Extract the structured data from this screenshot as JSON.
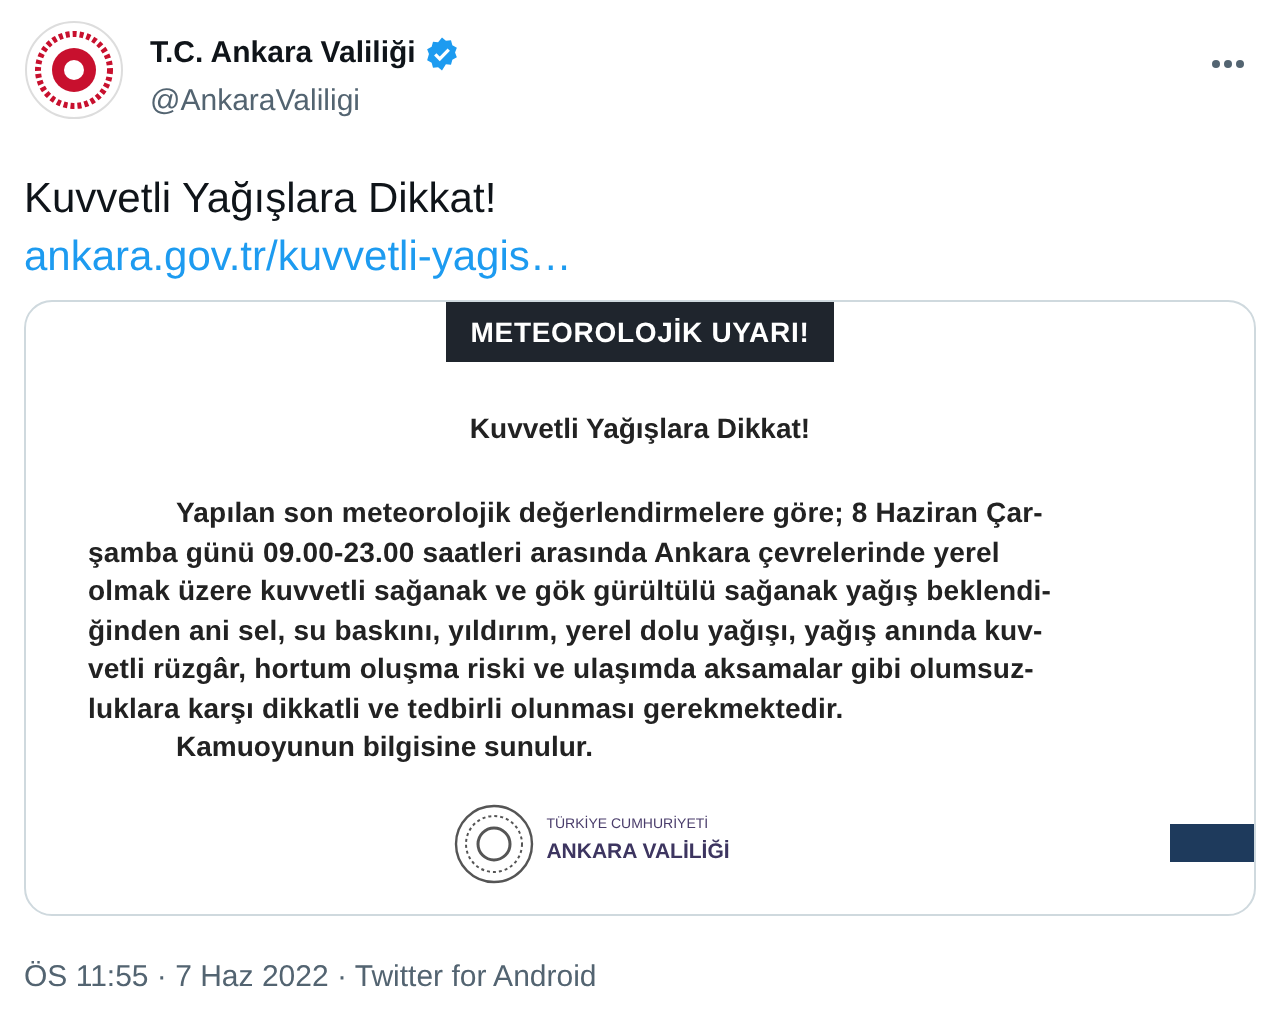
{
  "author": {
    "name": "T.C. Ankara Valiliği",
    "verified": true,
    "handle": "@AnkaraValiligi"
  },
  "tweet": {
    "text": "Kuvvetli Yağışlara Dikkat!",
    "link": "ankara.gov.tr/kuvvetli-yagis…"
  },
  "image": {
    "banner": "METEOROLOJİK UYARI!",
    "title": "Kuvvetli Yağışlara Dikkat!",
    "body_lines": [
      "Yapılan son meteorolojik değerlendirmelere göre; 8 Haziran Çar-",
      "şamba günü 09.00-23.00 saatleri arasında Ankara çevrelerinde yerel",
      "olmak üzere kuvvetli sağanak ve gök gürültülü sağanak yağış beklendi-",
      "ğinden ani sel, su baskını, yıldırım, yerel dolu yağışı, yağış anında kuv-",
      "vetli rüzgâr, hortum oluşma riski ve ulaşımda aksamalar gibi olumsuz-",
      "luklara karşı dikkatli ve tedbirli olunması gerekmektedir."
    ],
    "closing": "Kamuoyunun bilgisine sunulur.",
    "seal_top": "TÜRKİYE CUMHURİYETİ",
    "seal_name": "ANKARA VALİLİĞİ"
  },
  "meta": {
    "line": "ÖS 11:55 · 7 Haz 2022 · Twitter for Android"
  }
}
